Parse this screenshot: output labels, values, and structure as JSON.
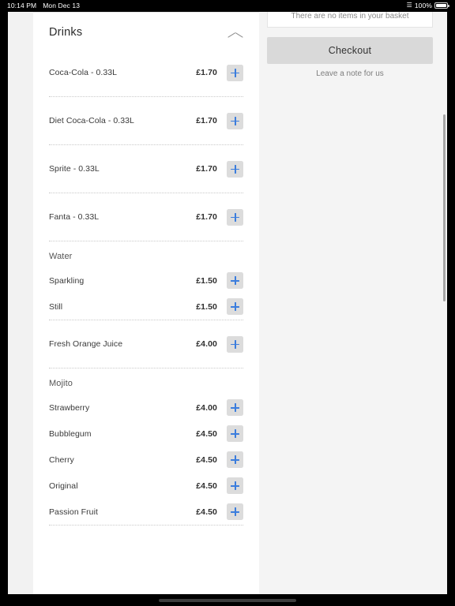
{
  "status_bar": {
    "time": "10:14 PM",
    "date": "Mon Dec 13",
    "wifi_icon": "wifi-icon",
    "battery_percent": "100%",
    "battery_icon": "battery-full-icon"
  },
  "menu": {
    "section": {
      "title": "Drinks",
      "collapse_icon": "chevron-up-icon"
    },
    "add_icon": "plus-icon",
    "groups": [
      {
        "label": null,
        "items": [
          {
            "name": "Coca-Cola - 0.33L",
            "price": "£1.70"
          },
          {
            "name": "Diet Coca-Cola - 0.33L",
            "price": "£1.70"
          },
          {
            "name": "Sprite - 0.33L",
            "price": "£1.70"
          },
          {
            "name": "Fanta - 0.33L",
            "price": "£1.70"
          }
        ]
      },
      {
        "label": "Water",
        "items": [
          {
            "name": "Sparkling",
            "price": "£1.50"
          },
          {
            "name": "Still",
            "price": "£1.50"
          }
        ]
      },
      {
        "label": null,
        "items": [
          {
            "name": "Fresh Orange Juice",
            "price": "£4.00"
          }
        ]
      },
      {
        "label": "Mojito",
        "items": [
          {
            "name": "Strawberry",
            "price": "£4.00"
          },
          {
            "name": "Bubblegum",
            "price": "£4.50"
          },
          {
            "name": "Cherry",
            "price": "£4.50"
          },
          {
            "name": "Original",
            "price": "£4.50"
          },
          {
            "name": "Passion Fruit",
            "price": "£4.50"
          }
        ]
      }
    ]
  },
  "basket": {
    "empty_text": "There are no items in your basket",
    "checkout_label": "Checkout",
    "note_label": "Leave a note for us"
  }
}
